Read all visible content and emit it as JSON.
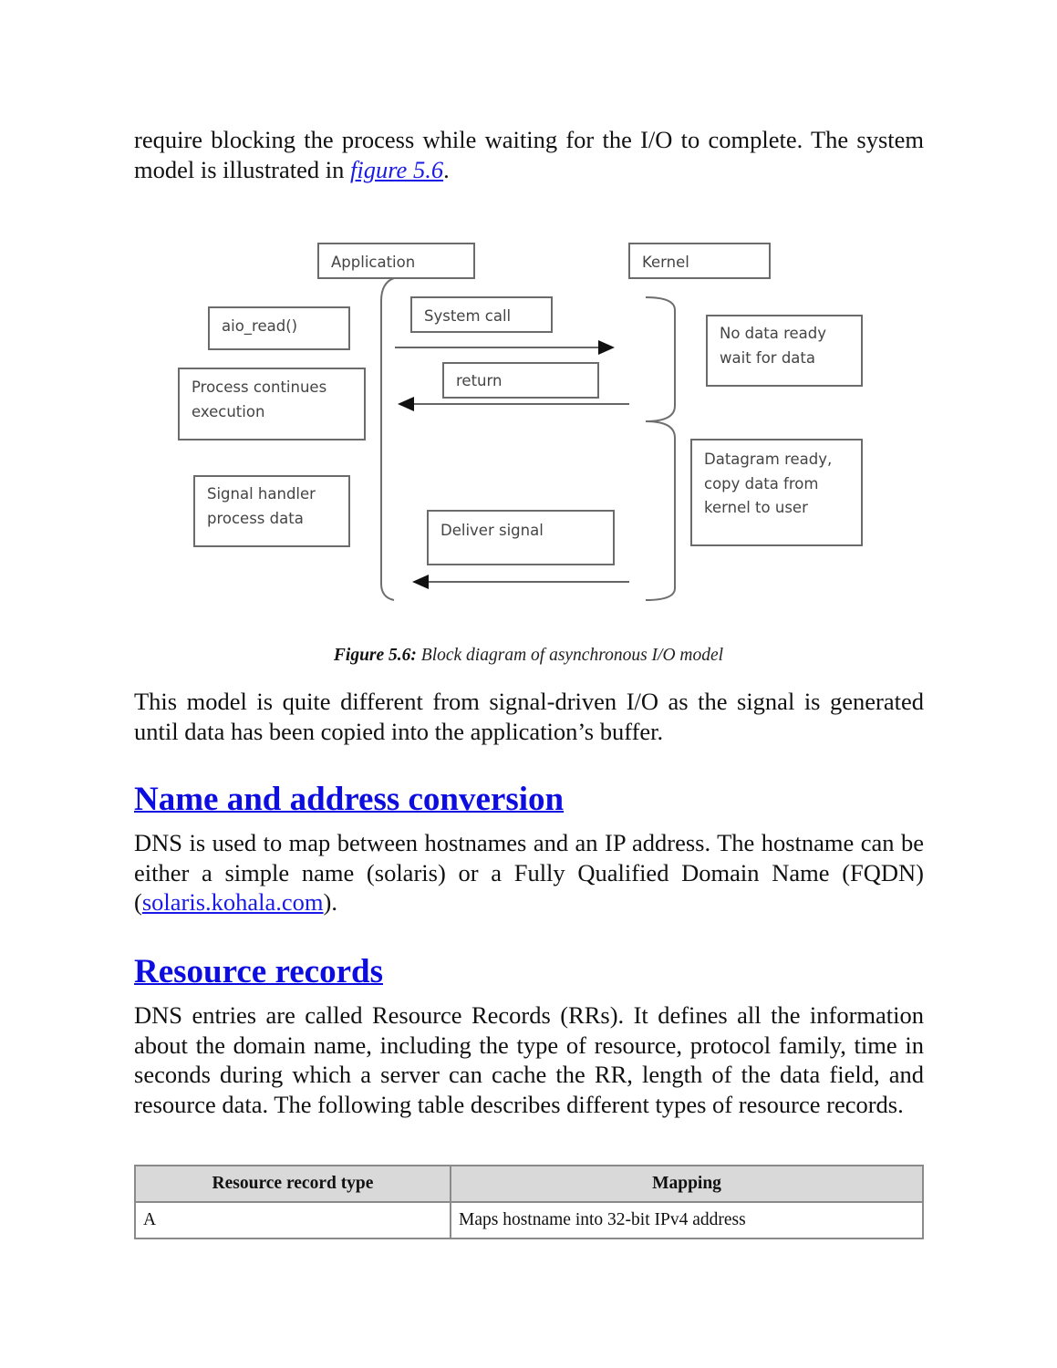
{
  "intro": {
    "text_before_link": "require blocking the process while waiting for the I/O to complete. The system model is illustrated in ",
    "link_text": "figure 5.6",
    "text_after_link": "."
  },
  "diagram": {
    "application_label": "Application",
    "kernel_label": "Kernel",
    "aio_read_label": "aio_read()",
    "process_continues_lines": [
      "Process continues",
      "execution"
    ],
    "signal_handler_lines": [
      "Signal handler",
      "process data"
    ],
    "system_call_label": "System call",
    "return_label": "return",
    "deliver_signal_label": "Deliver signal",
    "no_data_lines": [
      "No data ready",
      "wait for data"
    ],
    "datagram_ready_lines": [
      "Datagram ready,",
      "copy data from",
      "kernel to user"
    ]
  },
  "caption": {
    "label": "Figure 5.6:",
    "text": " Block diagram of asynchronous I/O model"
  },
  "after_figure_paragraph": "This model is quite different from signal-driven I/O as the signal is generated until data has been copied into the application’s buffer.",
  "section_name_address": {
    "heading": "Name and address conversion",
    "text_before_link": "DNS is used to map between hostnames and an IP address. The hostname can be either a simple name (solaris) or a Fully Qualified Domain Name (FQDN) (",
    "link_text": "solaris.kohala.com",
    "text_after_link": ")."
  },
  "section_resource_records": {
    "heading": "Resource records",
    "paragraph": "DNS entries are called Resource Records (RRs). It defines all the information about the domain name, including the type of resource, protocol family, time in seconds during which a server can cache the RR, length of the data field, and resource data. The following table describes different types of resource records."
  },
  "rr_table": {
    "headers": [
      "Resource record type",
      "Mapping"
    ],
    "rows": [
      [
        "A",
        "Maps hostname into 32-bit IPv4 address"
      ]
    ]
  }
}
